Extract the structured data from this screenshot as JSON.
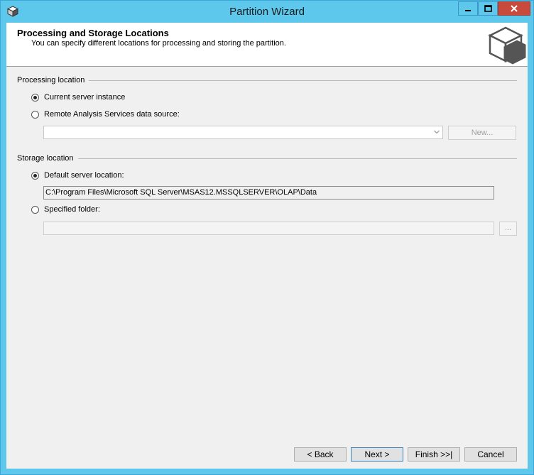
{
  "window": {
    "title": "Partition Wizard",
    "title_color": "#1a1a1a",
    "frame_color": "#5ec8ec",
    "close_color": "#c74a3d"
  },
  "header": {
    "title": "Processing and Storage Locations",
    "subtitle": "You can specify different locations for processing and storing the partition."
  },
  "processing": {
    "label": "Processing location",
    "option_current": "Current server instance",
    "option_remote": "Remote Analysis Services data source:",
    "selected": "current",
    "data_source_value": "",
    "new_button": "New..."
  },
  "storage": {
    "label": "Storage location",
    "option_default": "Default server location:",
    "default_path": "C:\\Program Files\\Microsoft SQL Server\\MSAS12.MSSQLSERVER\\OLAP\\Data",
    "option_specified": "Specified folder:",
    "selected": "default",
    "specified_value": "",
    "browse_button": "..."
  },
  "footer": {
    "back": "< Back",
    "next": "Next >",
    "finish": "Finish >>|",
    "cancel": "Cancel"
  }
}
